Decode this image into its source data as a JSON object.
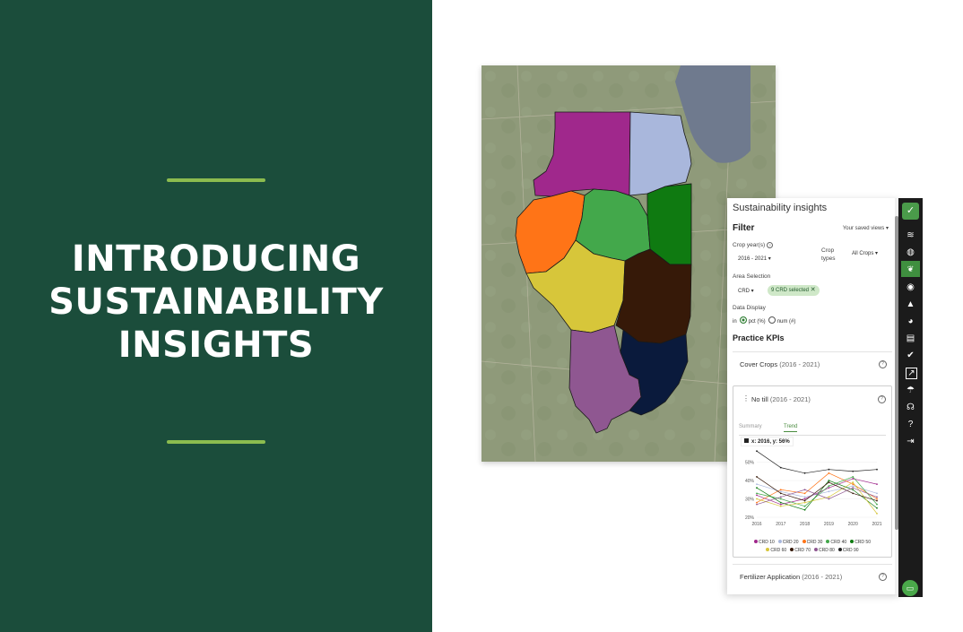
{
  "headline": {
    "line1": "INTRODUCING",
    "line2": "SUSTAINABILITY",
    "line3": "INSIGHTS"
  },
  "colors": {
    "left_bg": "#1b4d3b",
    "accent_rule": "#8cbc4f",
    "brand_green": "#2e7d32"
  },
  "map": {
    "regions": [
      {
        "name": "CRD 10",
        "color": "#a0288c"
      },
      {
        "name": "CRD 20",
        "color": "#a9b7dc"
      },
      {
        "name": "CRD 30",
        "color": "#ff7417"
      },
      {
        "name": "CRD 40",
        "color": "#43a84b"
      },
      {
        "name": "CRD 50",
        "color": "#0f7a11"
      },
      {
        "name": "CRD 60",
        "color": "#d7c63a"
      },
      {
        "name": "CRD 70",
        "color": "#361908"
      },
      {
        "name": "CRD 80",
        "color": "#8f5791"
      },
      {
        "name": "CRD 90",
        "color": "#0a1a3c"
      }
    ],
    "lake_color": "#6f7a8e"
  },
  "panel": {
    "title": "Sustainability insights",
    "filter_label": "Filter",
    "saved_views": "Your saved views",
    "crop_years_label": "Crop year(s)",
    "crop_years_value": "2016 - 2021",
    "crop_types_label_1": "Crop",
    "crop_types_label_2": "types",
    "crop_types_value": "All Crops",
    "area_selection_label": "Area Selection",
    "area_type": "CRD",
    "area_chip": "9 CRD selected",
    "data_display_label": "Data Display",
    "data_display_in": "in",
    "option_pct": "pct (%)",
    "option_num": "num (#)",
    "practice_kpis": "Practice KPIs",
    "cards": [
      {
        "title": "Cover Crops",
        "years": "(2016 - 2021)"
      },
      {
        "title": "No till",
        "years": "(2016 - 2021)"
      },
      {
        "title": "Fertilizer Application",
        "years": "(2016 - 2021)"
      }
    ],
    "tabs": {
      "summary": "Summary",
      "trend": "Trend"
    },
    "tooltip": "x: 2016, y: 56%"
  },
  "chart_data": {
    "type": "line",
    "x": [
      2016,
      2017,
      2018,
      2019,
      2020,
      2021
    ],
    "ylim": [
      20,
      60
    ],
    "yticks": [
      "20%",
      "30%",
      "40%",
      "50%"
    ],
    "xticks": [
      "2016",
      "2017",
      "2018",
      "2019",
      "2020",
      "2021"
    ],
    "series": [
      {
        "name": "CRD 10",
        "color": "#a0288c",
        "values": [
          32,
          27,
          30,
          36,
          41,
          38
        ]
      },
      {
        "name": "CRD 20",
        "color": "#a9b7dc",
        "values": [
          38,
          34,
          31,
          34,
          37,
          33
        ]
      },
      {
        "name": "CRD 30",
        "color": "#ff7417",
        "values": [
          28,
          35,
          33,
          44,
          38,
          30
        ]
      },
      {
        "name": "CRD 40",
        "color": "#43a84b",
        "values": [
          33,
          30,
          26,
          37,
          42,
          27
        ]
      },
      {
        "name": "CRD 50",
        "color": "#0f7a11",
        "values": [
          36,
          28,
          24,
          40,
          35,
          25
        ]
      },
      {
        "name": "CRD 60",
        "color": "#d7c63a",
        "values": [
          30,
          26,
          28,
          31,
          39,
          22
        ]
      },
      {
        "name": "CRD 70",
        "color": "#361908",
        "values": [
          42,
          33,
          29,
          39,
          33,
          29
        ]
      },
      {
        "name": "CRD 80",
        "color": "#8f5791",
        "values": [
          27,
          31,
          35,
          30,
          36,
          31
        ]
      },
      {
        "name": "CRD 90",
        "color": "#222222",
        "values": [
          56,
          47,
          44,
          46,
          45,
          46
        ]
      }
    ]
  },
  "rail_icons": [
    "logo-icon",
    "layers-icon",
    "globe-icon",
    "sprout-icon",
    "compass-icon",
    "warning-icon",
    "pie-icon",
    "report-icon",
    "check-icon",
    "insights-icon",
    "umbrella-icon",
    "support-icon",
    "help-icon",
    "logout-icon"
  ]
}
